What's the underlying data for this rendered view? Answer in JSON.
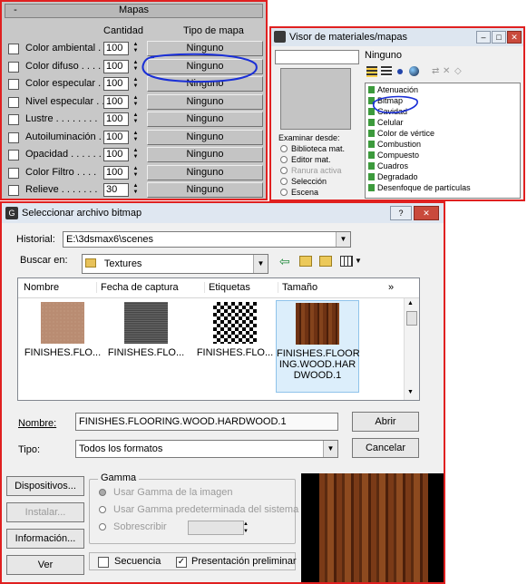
{
  "mapas": {
    "minus": "-",
    "title": "Mapas",
    "col_cantidad": "Cantidad",
    "col_tipo": "Tipo de mapa",
    "rows": [
      {
        "label": "Color ambiental . .",
        "value": "100",
        "map": "Ninguno"
      },
      {
        "label": "Color difuso . . . .",
        "value": "100",
        "map": "Ninguno"
      },
      {
        "label": "Color especular . .",
        "value": "100",
        "map": "Ninguno"
      },
      {
        "label": "Nivel especular . .",
        "value": "100",
        "map": "Ninguno"
      },
      {
        "label": "Lustre . . . . . . . .",
        "value": "100",
        "map": "Ninguno"
      },
      {
        "label": "Autoiluminación . .",
        "value": "100",
        "map": "Ninguno"
      },
      {
        "label": "Opacidad . . . . . .",
        "value": "100",
        "map": "Ninguno"
      },
      {
        "label": "Color Filtro . . . .",
        "value": "100",
        "map": "Ninguno"
      },
      {
        "label": "Relieve . . . . . . .",
        "value": "30",
        "map": "Ninguno"
      }
    ]
  },
  "visor": {
    "title": "Visor de materiales/mapas",
    "win_min": "–",
    "win_max": "□",
    "win_close": "✕",
    "name_value": "Ninguno",
    "browse_from": "Examinar desde:",
    "browse_options": [
      "Biblioteca mat.",
      "Editor mat.",
      "Ranura activa",
      "Selección",
      "Escena"
    ],
    "maps": [
      "Atenuación",
      "Bitmap",
      "Cavidad",
      "Celular",
      "Color de vértice",
      "Combustion",
      "Compuesto",
      "Cuadros",
      "Degradado",
      "Desenfoque de partículas"
    ]
  },
  "selector": {
    "title": "Seleccionar archivo bitmap",
    "help": "?",
    "close": "✕",
    "historial_label": "Historial:",
    "historial_value": "E:\\3dsmax6\\scenes",
    "buscar_label": "Buscar en:",
    "buscar_value": "Textures",
    "columns": [
      "Nombre",
      "Fecha de captura",
      "Etiquetas",
      "Tamaño",
      "»"
    ],
    "files": [
      {
        "name": "FINISHES.FLO..."
      },
      {
        "name": "FINISHES.FLO..."
      },
      {
        "name": "FINISHES.FLO..."
      },
      {
        "name_lines": [
          "FINISHES.FLOOR",
          "ING.WOOD.HAR",
          "DWOOD.1"
        ]
      }
    ],
    "nombre_label": "Nombre:",
    "nombre_value": "FINISHES.FLOORING.WOOD.HARDWOOD.1",
    "tipo_label": "Tipo:",
    "tipo_value": "Todos los formatos",
    "abrir": "Abrir",
    "cancelar": "Cancelar",
    "dispositivos": "Dispositivos...",
    "instalar": "Instalar...",
    "informacion": "Información...",
    "ver": "Ver",
    "gamma_title": "Gamma",
    "gamma_opts": [
      "Usar Gamma de la imagen",
      "Usar Gamma predeterminada del sistema",
      "Sobrescribir"
    ],
    "secuencia": "Secuencia",
    "preview": "Presentación preliminar"
  },
  "colors": {
    "frame": "#e02020",
    "annotation": "#1a2fd6",
    "wood": "#6b3214"
  }
}
